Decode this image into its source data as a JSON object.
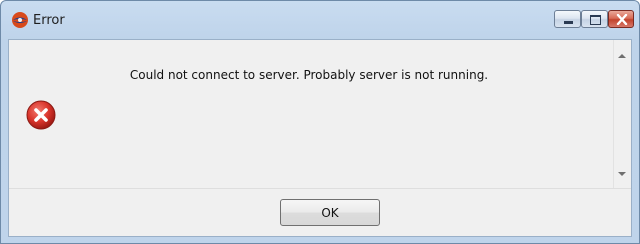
{
  "window": {
    "title": "Error",
    "icon": "app-logo-icon",
    "controls": [
      "minimize-icon",
      "maximize-icon",
      "close-icon"
    ]
  },
  "dialog": {
    "icon": "error-icon",
    "message": "Could not connect to server. Probably server is not running.",
    "ok_label": "OK"
  },
  "colors": {
    "error_red": "#d9342b",
    "close_button": "#c2432c",
    "client_background": "#f0f0f0"
  }
}
